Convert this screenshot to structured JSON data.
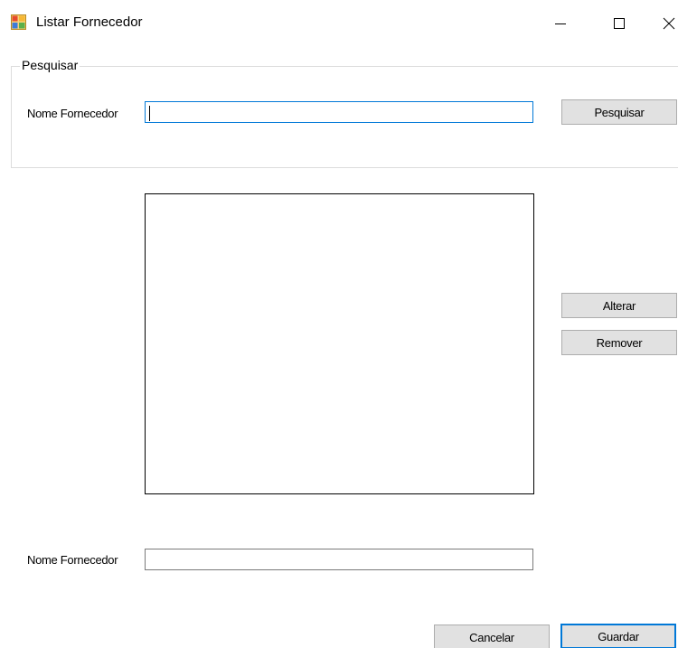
{
  "window": {
    "title": "Listar Fornecedor",
    "icon": "windows-form-icon"
  },
  "title_controls": {
    "minimize": "minimize-icon",
    "maximize": "maximize-icon",
    "close": "close-icon"
  },
  "search_group": {
    "legend": "Pesquisar",
    "name_label": "Nome Fornecedor",
    "name_value": "",
    "search_button": "Pesquisar"
  },
  "results": {
    "items": []
  },
  "side_actions": {
    "edit_button": "Alterar",
    "remove_button": "Remover"
  },
  "edit_form": {
    "name_label": "Nome Fornecedor",
    "name_value": ""
  },
  "footer": {
    "cancel_button": "Cancelar",
    "save_button": "Guardar"
  },
  "colors": {
    "focus_border": "#0078d7",
    "button_face": "#e1e1e1",
    "button_border": "#adadad",
    "groupbox_border": "#dcdcdc"
  }
}
